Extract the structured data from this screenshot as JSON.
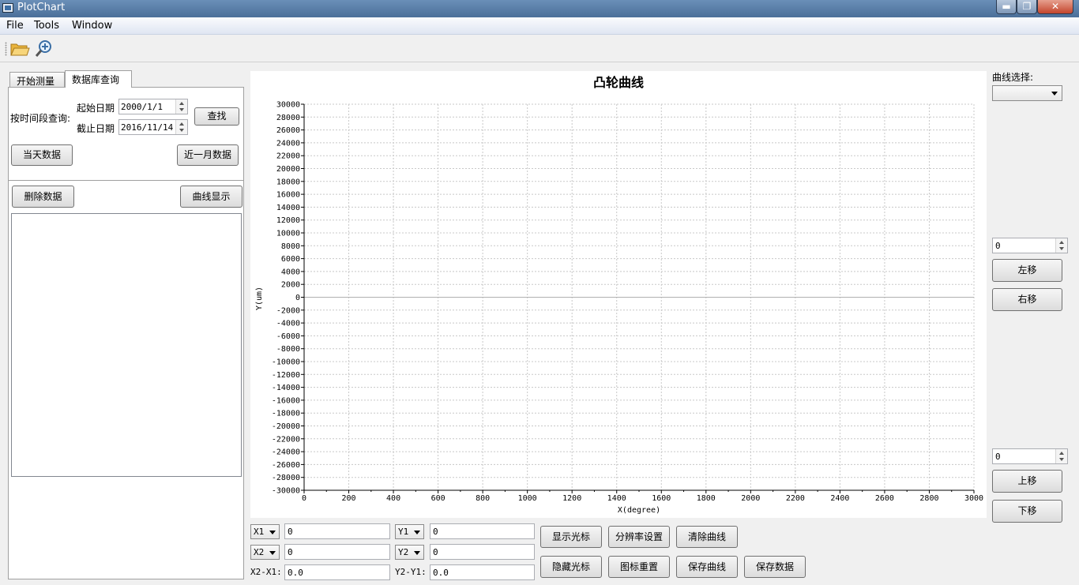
{
  "window": {
    "title": "PlotChart",
    "min_icon": "minimize-icon",
    "max_icon": "maximize-icon",
    "close_icon": "close-icon",
    "close_glyph": "✕",
    "min_glyph": "▬",
    "max_glyph": "❐"
  },
  "menu": [
    "File",
    "Tools",
    "Window"
  ],
  "toolbar": {
    "open_icon": "folder-open-icon",
    "zoom_icon": "zoom-in-icon"
  },
  "tabs": {
    "measure": "开始测量",
    "db_query": "数据库查询"
  },
  "query": {
    "time_range_label": "按时间段查询:",
    "start_label": "起始日期",
    "start_value": "2000/1/1",
    "end_label": "截止日期",
    "end_value": "2016/11/14",
    "search_button": "查找",
    "today_button": "当天数据",
    "month_button": "近一月数据",
    "delete_button": "删除数据",
    "show_curve_button": "曲线显示"
  },
  "chart_data": {
    "type": "line",
    "title": "凸轮曲线",
    "xlabel": "X(degree)",
    "ylabel": "Y(um)",
    "xlim": [
      0,
      3000
    ],
    "ylim": [
      -30000,
      30000
    ],
    "x_ticks": [
      0,
      200,
      400,
      600,
      800,
      1000,
      1200,
      1400,
      1600,
      1800,
      2000,
      2200,
      2400,
      2600,
      2800,
      3000
    ],
    "y_ticks": [
      30000,
      28000,
      26000,
      24000,
      22000,
      20000,
      18000,
      16000,
      14000,
      12000,
      10000,
      8000,
      6000,
      4000,
      2000,
      0,
      -2000,
      -4000,
      -6000,
      -8000,
      -10000,
      -12000,
      -14000,
      -16000,
      -18000,
      -20000,
      -22000,
      -24000,
      -26000,
      -28000,
      -30000
    ],
    "grid": true,
    "series": []
  },
  "cursor": {
    "x1_label": "X1",
    "x2_label": "X2",
    "y1_label": "Y1",
    "y2_label": "Y2",
    "x1_value": "0",
    "x2_value": "0",
    "y1_value": "0",
    "y2_value": "0",
    "dx_label": "X2-X1:",
    "dx_value": "0.0",
    "dy_label": "Y2-Y1:",
    "dy_value": "0.0"
  },
  "actions": {
    "show_cursor": "显示光标",
    "resolution": "分辨率设置",
    "clear_curve": "清除曲线",
    "hide_cursor": "隐藏光标",
    "reset_chart": "图标重置",
    "save_curve": "保存曲线",
    "save_data": "保存数据"
  },
  "right": {
    "curve_select_label": "曲线选择:",
    "curve_select_value": "",
    "h_offset": "0",
    "left_button": "左移",
    "right_button": "右移",
    "v_offset": "0",
    "up_button": "上移",
    "down_button": "下移"
  },
  "colors": {
    "grid": "#c8c8c8",
    "axis": "#000000",
    "titlebar": "#4b6f99"
  }
}
